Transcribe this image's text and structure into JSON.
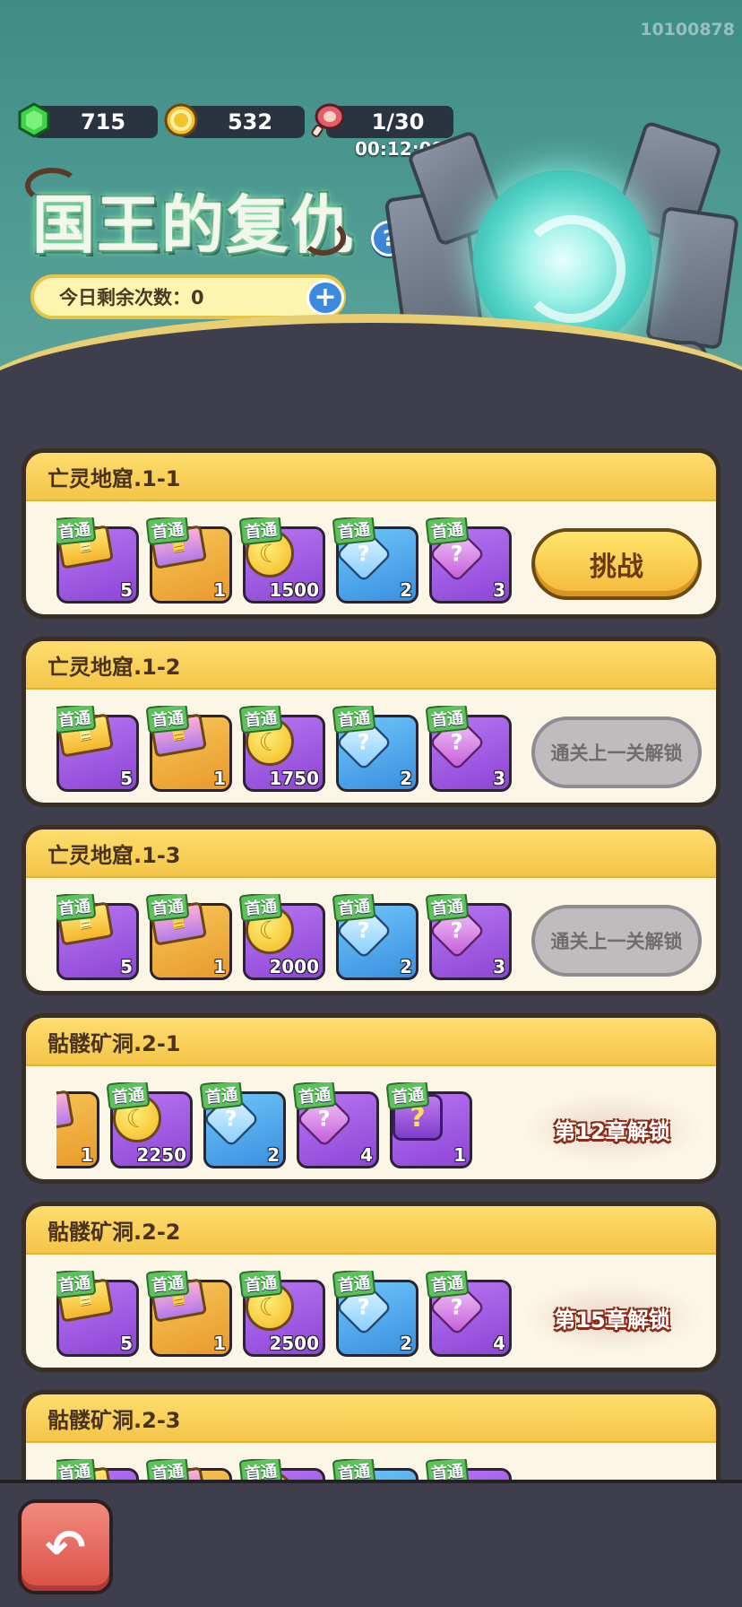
{
  "uid": "10100878",
  "resources": {
    "gems": "715",
    "coins": "532",
    "stamina": "1/30",
    "timer": "00:12:08"
  },
  "title": "国王的复仇",
  "daily": {
    "label": "今日剩余次数：0"
  },
  "icons": {
    "gem": "gem-icon",
    "coin": "coin-icon",
    "meat": "meat-icon",
    "help": "help-icon",
    "plus": "plus-icon",
    "back": "back-arrow-icon"
  },
  "first_clear_tag": "首通",
  "stages": [
    {
      "name": "亡灵地窟.1-1",
      "rewards": [
        {
          "type": "gold-ticket",
          "count": "5"
        },
        {
          "type": "pink-ticket",
          "count": "1"
        },
        {
          "type": "coin",
          "count": "1500"
        },
        {
          "type": "blue-gem",
          "count": "2"
        },
        {
          "type": "purple-gem",
          "count": "3"
        }
      ],
      "action": {
        "kind": "challenge",
        "label": "挑战"
      }
    },
    {
      "name": "亡灵地窟.1-2",
      "rewards": [
        {
          "type": "gold-ticket",
          "count": "5"
        },
        {
          "type": "pink-ticket",
          "count": "1"
        },
        {
          "type": "coin",
          "count": "1750"
        },
        {
          "type": "blue-gem",
          "count": "2"
        },
        {
          "type": "purple-gem",
          "count": "3"
        }
      ],
      "action": {
        "kind": "locked",
        "label": "通关上一关解锁"
      }
    },
    {
      "name": "亡灵地窟.1-3",
      "rewards": [
        {
          "type": "gold-ticket",
          "count": "5"
        },
        {
          "type": "pink-ticket",
          "count": "1"
        },
        {
          "type": "coin",
          "count": "2000"
        },
        {
          "type": "blue-gem",
          "count": "2"
        },
        {
          "type": "purple-gem",
          "count": "3"
        }
      ],
      "action": {
        "kind": "locked",
        "label": "通关上一关解锁"
      }
    },
    {
      "name": "骷髅矿洞.2-1",
      "rewards": [
        {
          "type": "pink-ticket",
          "count": "1"
        },
        {
          "type": "coin",
          "count": "2250"
        },
        {
          "type": "blue-gem",
          "count": "2"
        },
        {
          "type": "purple-gem",
          "count": "4"
        },
        {
          "type": "mystery-chest",
          "count": "1"
        }
      ],
      "action": {
        "kind": "chapter",
        "label": "第12章解锁"
      }
    },
    {
      "name": "骷髅矿洞.2-2",
      "rewards": [
        {
          "type": "gold-ticket",
          "count": "5"
        },
        {
          "type": "pink-ticket",
          "count": "1"
        },
        {
          "type": "coin",
          "count": "2500"
        },
        {
          "type": "blue-gem",
          "count": "2"
        },
        {
          "type": "purple-gem",
          "count": "4"
        }
      ],
      "action": {
        "kind": "chapter",
        "label": "第15章解锁"
      }
    },
    {
      "name": "骷髅矿洞.2-3",
      "rewards": [
        {
          "type": "gold-ticket",
          "count": ""
        },
        {
          "type": "pink-ticket",
          "count": ""
        },
        {
          "type": "coin",
          "count": ""
        },
        {
          "type": "blue-gem",
          "count": ""
        },
        {
          "type": "purple-gem",
          "count": ""
        }
      ],
      "action": {
        "kind": "none",
        "label": ""
      }
    }
  ],
  "colors": {
    "header_bg": "#4b9891",
    "card_head": "#f3c548",
    "challenge_btn": "#f4b83a",
    "locked_btn": "#bfbcbe",
    "back_btn": "#d94f45"
  }
}
